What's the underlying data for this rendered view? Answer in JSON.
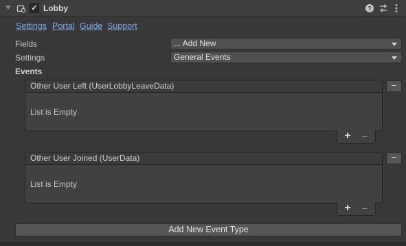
{
  "header": {
    "title": "Lobby",
    "enabled_glyph": "✓",
    "icons": [
      "component-icon",
      "help-icon",
      "presets-icon",
      "more-menu-icon"
    ]
  },
  "links": [
    "Settings",
    "Portal",
    "Guide",
    "Support"
  ],
  "fields": {
    "fields_label": "Fields",
    "fields_value": "... Add New",
    "settings_label": "Settings",
    "settings_value": "General Events",
    "events_label": "Events"
  },
  "events": [
    {
      "title": "Other User Left (UserLobbyLeaveData)",
      "empty_text": "List is Empty",
      "remove": "−",
      "add": "+",
      "sub": "−"
    },
    {
      "title": "Other User Joined (UserData)",
      "empty_text": "List is Empty",
      "remove": "−",
      "add": "+",
      "sub": "−"
    }
  ],
  "add_button": "Add New Event Type",
  "colors": {
    "background": "#383838",
    "link": "#7ca8e6",
    "field": "#505050",
    "button": "#565656"
  }
}
